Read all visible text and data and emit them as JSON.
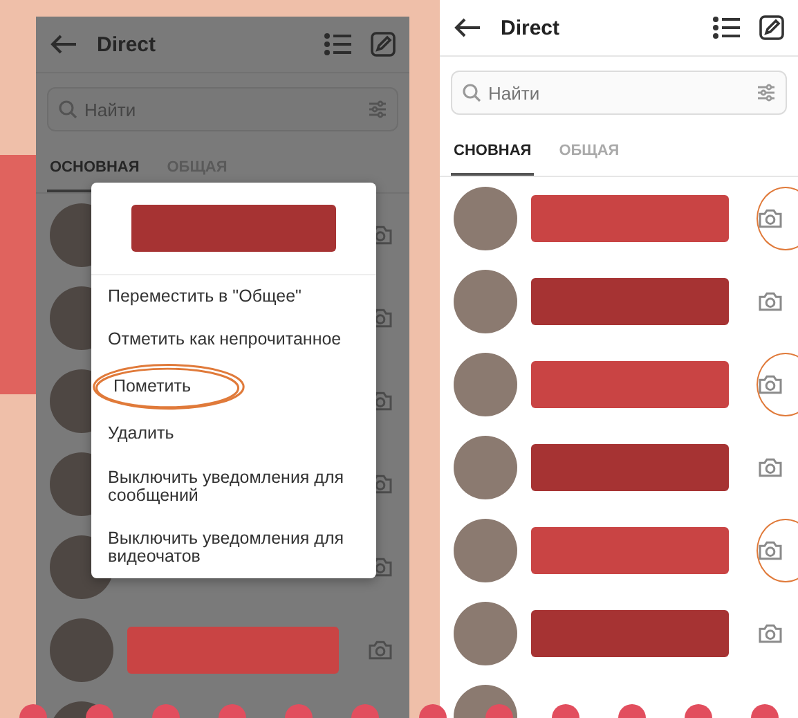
{
  "left_screen": {
    "dimmed": true,
    "title": "Direct",
    "search": {
      "placeholder": "Найти"
    },
    "tabs": [
      {
        "label": "ОСНОВНАЯ",
        "selected": true
      },
      {
        "label": "ОБЩАЯ",
        "selected": false
      }
    ],
    "chats": [
      {
        "camera": true
      },
      {
        "camera": true
      },
      {
        "camera": true
      },
      {
        "camera": true
      },
      {
        "camera": true
      },
      {
        "color": "#c94444",
        "camera": true
      },
      {
        "camera": false
      }
    ],
    "menu": {
      "items": [
        {
          "label": "Переместить в \"Общее\"",
          "circled": false
        },
        {
          "label": "Отметить как непрочитанное",
          "circled": false
        },
        {
          "label": "Пометить",
          "circled": true
        },
        {
          "label": "Удалить",
          "circled": false
        },
        {
          "label": "Выключить уведомления для сообщений",
          "circled": false
        },
        {
          "label": "Выключить уведомления для видеочатов",
          "circled": false
        }
      ]
    }
  },
  "right_screen": {
    "title": "Direct",
    "search": {
      "placeholder": "Найти"
    },
    "tabs": [
      {
        "label": "СНОВНАЯ",
        "selected": true
      },
      {
        "label": "ОБЩАЯ",
        "selected": false
      }
    ],
    "chats": [
      {
        "color": "#c94444",
        "camera": true,
        "circled": true
      },
      {
        "color": "#a63333",
        "camera": true,
        "circled": false
      },
      {
        "color": "#c94444",
        "camera": true,
        "circled": true
      },
      {
        "color": "#a63333",
        "camera": true,
        "circled": false
      },
      {
        "color": "#c94444",
        "camera": true,
        "circled": true
      },
      {
        "color": "#a63333",
        "camera": true,
        "circled": false
      },
      {
        "camera": false
      }
    ]
  }
}
